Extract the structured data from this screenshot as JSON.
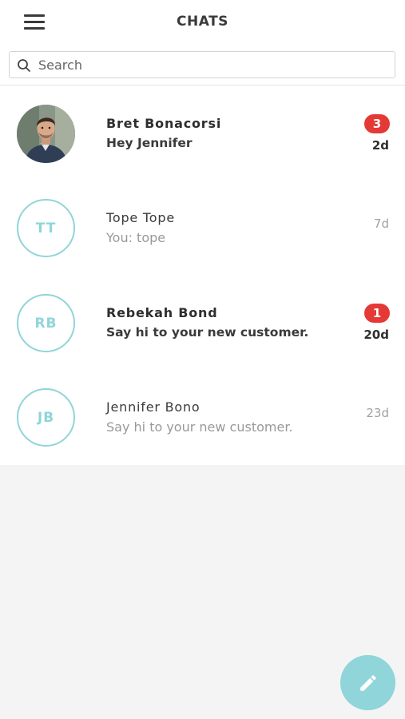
{
  "header": {
    "title": "CHATS",
    "menu_icon": "hamburger-menu-icon"
  },
  "search": {
    "placeholder": "Search",
    "value": "",
    "icon": "search-icon"
  },
  "chats": [
    {
      "name": "Bret Bonacorsi",
      "last_message": "Hey Jennifer",
      "time": "2d",
      "unread_count": "3",
      "avatar": "photo"
    },
    {
      "name": "Tope Tope",
      "last_message": "You: tope",
      "time": "7d",
      "unread_count": "",
      "avatar_initials": "TT"
    },
    {
      "name": "Rebekah Bond",
      "last_message": "Say hi to your new customer.",
      "time": "20d",
      "unread_count": "1",
      "avatar_initials": "RB"
    },
    {
      "name": "Jennifer Bono",
      "last_message": "Say hi to your new customer.",
      "time": "23d",
      "unread_count": "",
      "avatar_initials": "JB"
    }
  ],
  "fab": {
    "icon": "pencil-icon"
  },
  "colors": {
    "accent": "#8fd5d9",
    "badge": "#e53935",
    "background": "#f4f4f4"
  }
}
